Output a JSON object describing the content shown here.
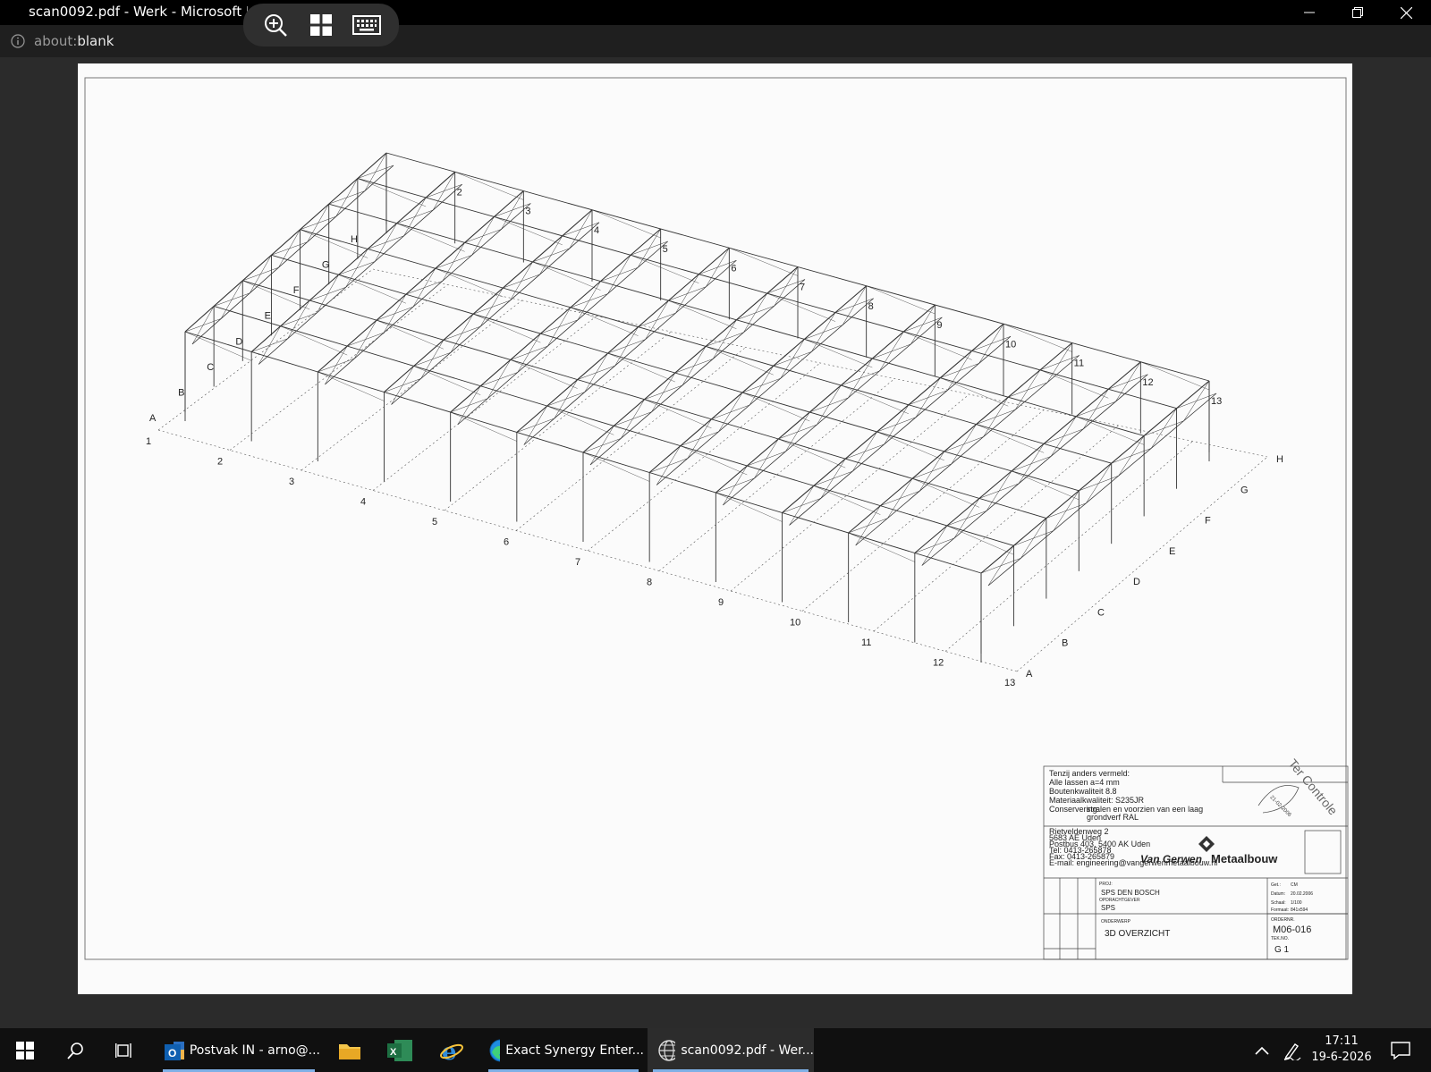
{
  "window": {
    "title": "scan0092.pdf - Werk - Microsoft E",
    "controls": [
      "minimize-icon",
      "restore-icon",
      "close-icon"
    ]
  },
  "pdf_toolbar": {
    "tools": [
      "zoom-in-icon",
      "page-view-icon",
      "keyboard-icon"
    ]
  },
  "address_bar": {
    "scheme": "about:",
    "host": "blank"
  },
  "drawing": {
    "column_labels": [
      "1",
      "2",
      "3",
      "4",
      "5",
      "6",
      "7",
      "8",
      "9",
      "10",
      "11",
      "12",
      "13"
    ],
    "column_labels_back": [
      "2",
      "3",
      "4",
      "5",
      "6",
      "7",
      "8",
      "9",
      "10",
      "11",
      "12",
      "13"
    ],
    "row_labels_left": [
      "A",
      "B",
      "C",
      "D",
      "E",
      "F",
      "G",
      "H"
    ],
    "row_labels_right": [
      "H",
      "G",
      "F",
      "E",
      "D",
      "C",
      "B",
      "A"
    ],
    "title_block": {
      "notes_heading": "Tenzij anders vermeld:",
      "note_lines": [
        "Alle lassen a=4 mm",
        "Boutenkwaliteit 8.8",
        "Materiaalkwaliteit: S235JR",
        "Conservering:",
        "stralen en voorzien van een laag",
        "grondverf RAL"
      ],
      "company": "Van Gerwen",
      "company_suffix": "Metaalbouw",
      "address_lines": [
        "Rietveldenweg 2",
        "5683 AE Uden",
        "Postbus 403, 5400 AK Uden",
        "Tel: 0413-265878",
        "Fax: 0413-265879",
        "E-mail: engineering@vangerwenmetaalbouw.nl"
      ],
      "project_label": "PROJ:",
      "project": "SPS DEN BOSCH",
      "client_label": "OPDRACHTGEVER",
      "client": "SPS",
      "subject_label": "ONDERWERP",
      "subject": "3D OVERZICHT",
      "order_label": "ORDERNR.",
      "order": "M06-016",
      "drawing_no_label": "TEK.NO.",
      "drawing_no": "G 1",
      "meta": [
        {
          "k": "Get.:",
          "v": "CM"
        },
        {
          "k": "Datum:",
          "v": "20.02.2006"
        },
        {
          "k": "Schaal:",
          "v": "1/100"
        },
        {
          "k": "Formaat:",
          "v": "841x594"
        }
      ],
      "controle_stamp": "Ter Controle",
      "stamp_date": "21-02-2006"
    }
  },
  "taskbar": {
    "apps": [
      {
        "name": "outlook",
        "label": "Postvak IN - arno@...",
        "underline": true
      },
      {
        "name": "file-explorer",
        "label": "",
        "underline": false
      },
      {
        "name": "excel",
        "label": "",
        "underline": false
      },
      {
        "name": "internet-explorer",
        "label": "",
        "underline": false
      },
      {
        "name": "edge",
        "label": "Exact Synergy Enter...",
        "underline": true
      },
      {
        "name": "edge-pdf",
        "label": "scan0092.pdf - Wer...",
        "underline": true
      }
    ],
    "time": "17:11",
    "date": "19-6-2026"
  }
}
